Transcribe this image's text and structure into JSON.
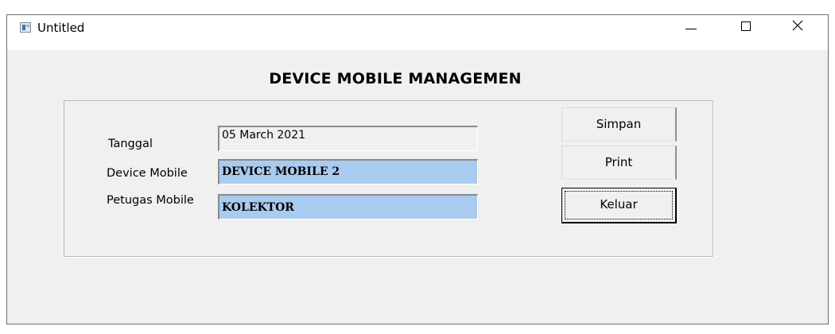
{
  "window": {
    "title": "Untitled",
    "controls": {
      "minimize": "minimize-icon",
      "maximize": "maximize-icon",
      "close": "close-icon"
    }
  },
  "form": {
    "heading": "DEVICE MOBILE MANAGEMEN",
    "fields": {
      "tanggal": {
        "label": "Tanggal",
        "value": "05 March 2021"
      },
      "device_mobile": {
        "label": "Device Mobile",
        "value": "DEVICE MOBILE 2"
      },
      "petugas_mobile": {
        "label": "Petugas Mobile",
        "value": "KOLEKTOR"
      }
    },
    "buttons": {
      "simpan": "Simpan",
      "print": "Print",
      "keluar": "Keluar"
    }
  },
  "colors": {
    "window_bg": "#f0f0f0",
    "titlebar_bg": "#ffffff",
    "highlight_field_bg": "#a9cbf0"
  }
}
